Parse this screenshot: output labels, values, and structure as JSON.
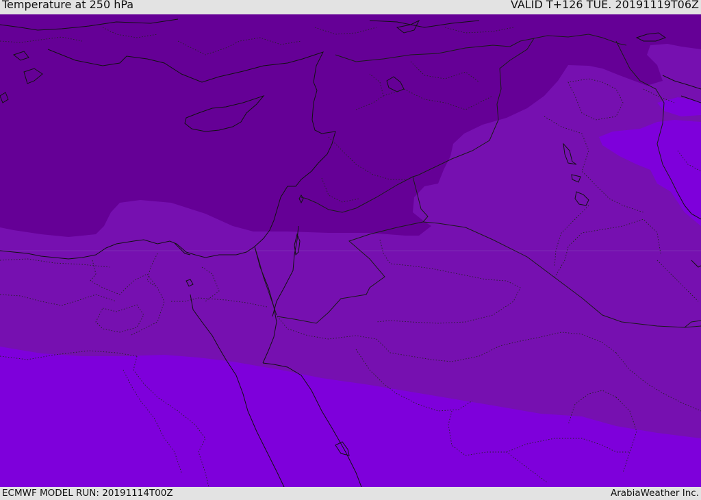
{
  "header": {
    "title": "Temperature at 250 hPa",
    "valid_time": "VALID T+126 TUE. 20191119T06Z"
  },
  "footer": {
    "model_run": "ECMWF MODEL RUN: 20191114T00Z",
    "credit": "ArabiaWeather Inc."
  },
  "map": {
    "region": "Eastern Mediterranean / Middle East",
    "colors": {
      "cold_band": "#650096",
      "mid_band": "#7610b0",
      "warm_band": "#7e00db",
      "coastline": "#111111",
      "border": "#222222"
    }
  }
}
